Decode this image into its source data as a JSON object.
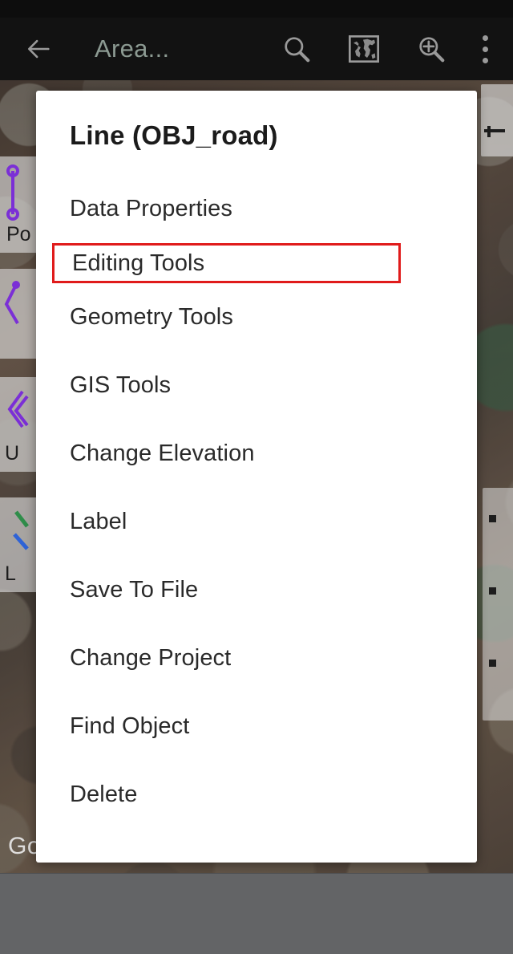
{
  "app_bar": {
    "back_icon": "back-arrow-icon",
    "title": "Area...",
    "icons": [
      {
        "name": "search-icon",
        "glyph": "magnifier"
      },
      {
        "name": "world-map-icon",
        "glyph": "globe-frame"
      },
      {
        "name": "zoom-in-icon",
        "glyph": "magnifier-plus"
      },
      {
        "name": "overflow-menu-icon",
        "glyph": "three-dots-vertical"
      }
    ]
  },
  "map": {
    "attribution": "Go",
    "legend_cards": [
      {
        "label": "Po",
        "line_color": "#7b2fd6"
      },
      {
        "label": "",
        "line_color": "#7b2fd6"
      },
      {
        "label": "U",
        "line_color": "#7b2fd6"
      },
      {
        "label": "L",
        "line_color": "#2f63d6"
      }
    ]
  },
  "dialog": {
    "title": "Line (OBJ_road)",
    "highlight_color": "#e01b1b",
    "highlighted_item": "Editing Tools",
    "items": [
      {
        "label": "Data Properties",
        "highlighted": false
      },
      {
        "label": "Editing Tools",
        "highlighted": true
      },
      {
        "label": "Geometry Tools",
        "highlighted": false
      },
      {
        "label": "GIS Tools",
        "highlighted": false
      },
      {
        "label": "Change Elevation",
        "highlighted": false
      },
      {
        "label": "Label",
        "highlighted": false
      },
      {
        "label": "Save To File",
        "highlighted": false
      },
      {
        "label": "Change Project",
        "highlighted": false
      },
      {
        "label": "Find Object",
        "highlighted": false
      },
      {
        "label": "Delete",
        "highlighted": false
      }
    ]
  }
}
